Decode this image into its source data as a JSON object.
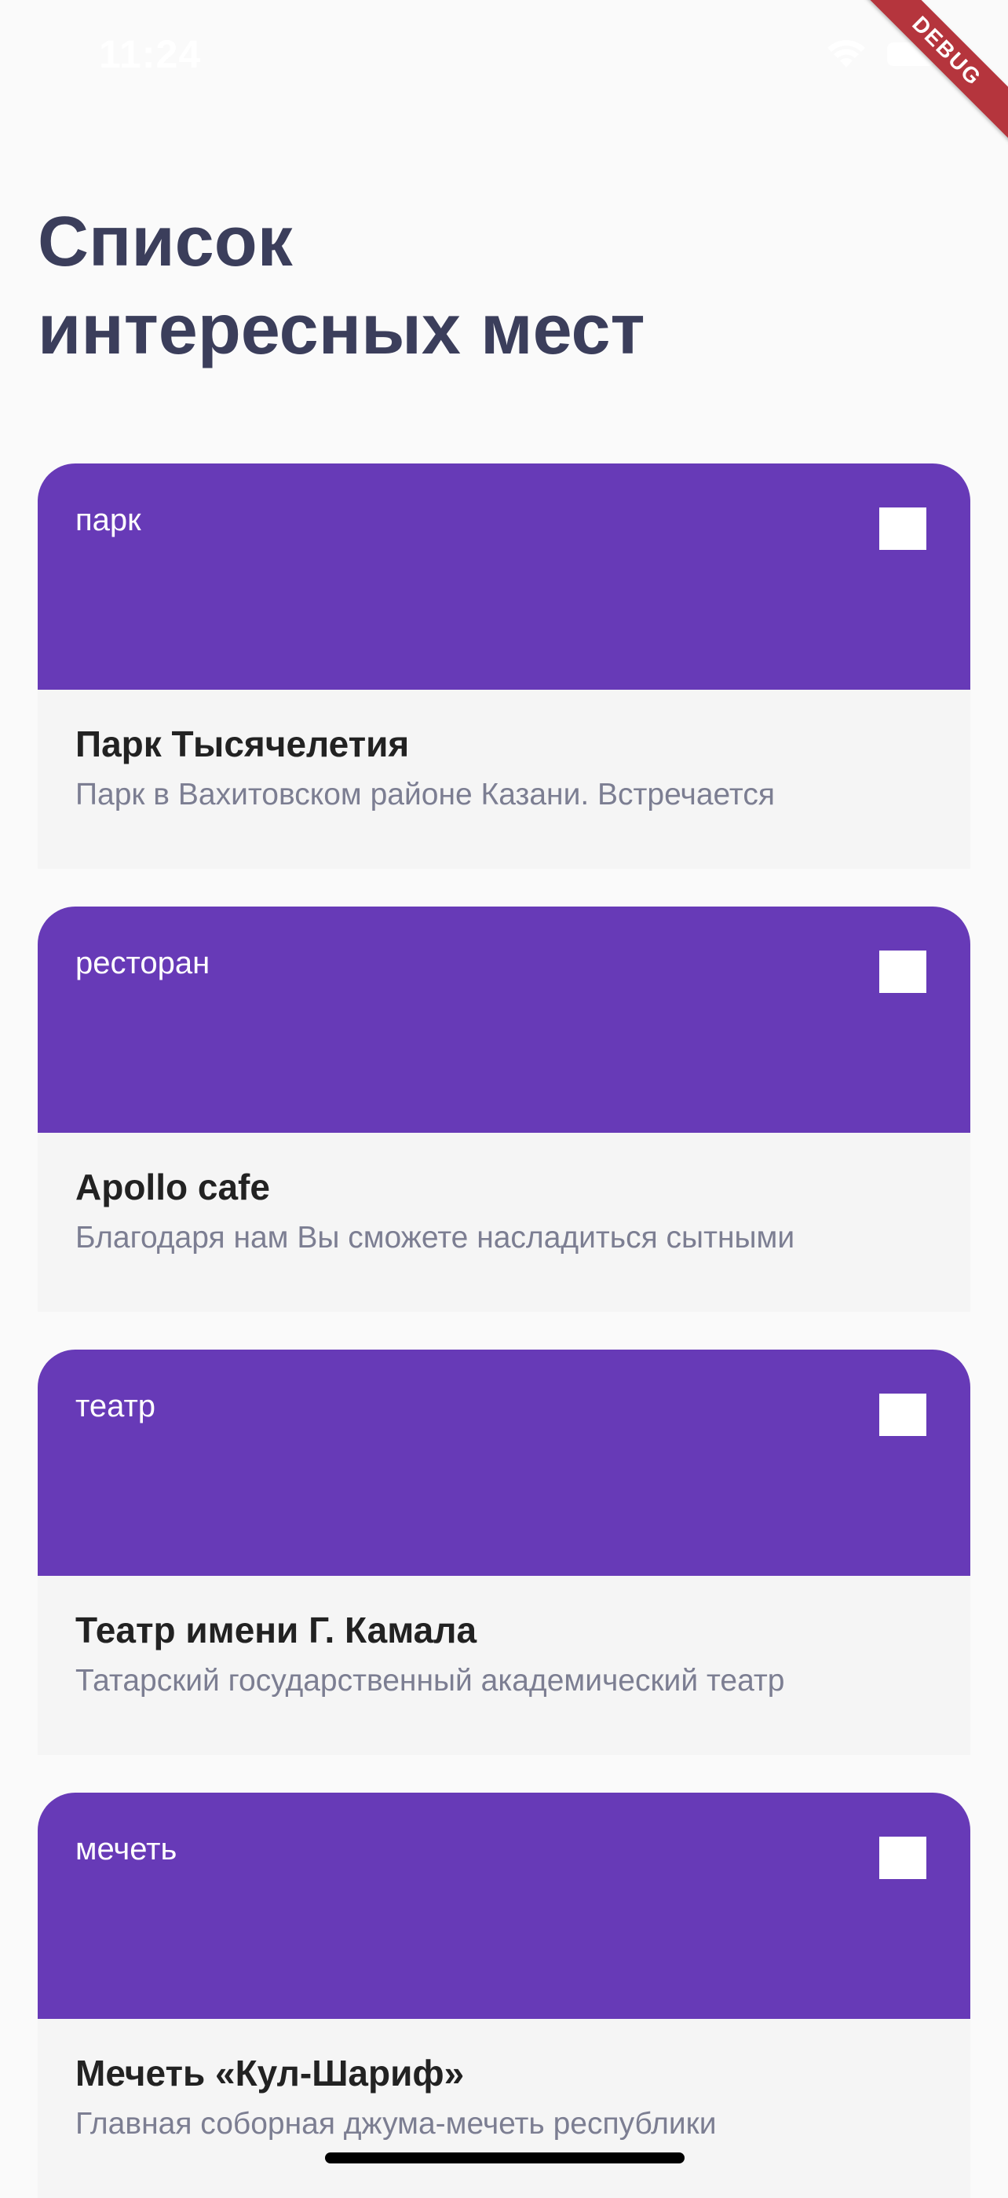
{
  "status_bar": {
    "time": "11:24"
  },
  "debug_banner": "DEBUG",
  "title": {
    "line1": "Список",
    "line2": "интересных мест"
  },
  "colors": {
    "accent": "#673ab7",
    "title": "#3b3e5b",
    "card_bg": "#f5f5f5",
    "description": "#7c7e92",
    "debug_ribbon": "#b5353d"
  },
  "places": [
    {
      "type": "парк",
      "name": "Парк Тысячелетия",
      "description": "Парк в Вахитовском районе Казани. Встречается"
    },
    {
      "type": "ресторан",
      "name": "Apollo cafe",
      "description": "Благодаря нам Вы сможете насладиться сытными"
    },
    {
      "type": "театр",
      "name": "Театр имени Г. Камала",
      "description": "Татарский государственный академический театр"
    },
    {
      "type": "мечеть",
      "name": "Мечеть «Кул-Шариф»",
      "description": "Главная соборная джума-мечеть республики"
    }
  ]
}
